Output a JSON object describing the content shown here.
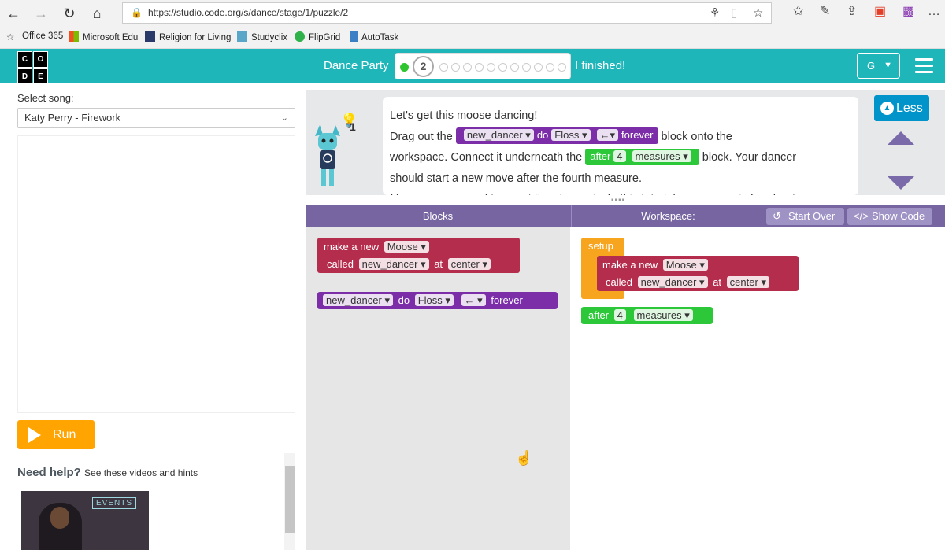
{
  "browser": {
    "url": "https://studio.code.org/s/dance/stage/1/puzzle/2",
    "bookmarks": [
      "Office 365",
      "Microsoft Edu",
      "Religion for Living",
      "Studyclix",
      "FlipGrid",
      "AutoTask"
    ]
  },
  "header": {
    "logo_letters": [
      "C",
      "O",
      "D",
      "E"
    ],
    "level_label": "Dance Party",
    "current_puzzle": "2",
    "finished_label": "I finished!",
    "user_initial": "G",
    "brand_color": "#1fb6ba"
  },
  "left_panel": {
    "song_label": "Select song:",
    "song_value": "Katy Perry - Firework",
    "run_label": "Run",
    "help_title": "Need help?",
    "help_subtitle": "See these videos and hints",
    "video_caption": "EVENTS"
  },
  "instructions": {
    "hint_count": "1",
    "line1": "Let's get this moose dancing!",
    "line2_pre": "Drag out the",
    "line2_post": "block onto the",
    "line3_pre": "workspace. Connect it underneath the",
    "line3_post": "block. Your dancer",
    "line4": "should start a new move after the fourth measure.",
    "line5": "Measures are used to count time in music. In this tutorial, a measure is four beats.",
    "less_label": "Less"
  },
  "workspace_header": {
    "blocks_label": "Blocks",
    "workspace_label": "Workspace:",
    "start_over_label": "Start Over",
    "show_code_label": "Show Code"
  },
  "blocks": {
    "make_a_new": "make a new",
    "moose": "Moose",
    "called": "called",
    "new_dancer": "new_dancer",
    "at": "at",
    "center": "center",
    "do": "do",
    "floss": "Floss",
    "arrow": "←",
    "forever": "forever",
    "setup": "setup",
    "after": "after",
    "four": "4",
    "measures": "measures",
    "drop_arrow": "▾"
  },
  "colors": {
    "purple_block": "#7b2ea8",
    "green_block": "#2dc83a",
    "red_block": "#b52d4c",
    "orange_block": "#f7a51e",
    "run_button": "#ffa400",
    "less_button": "#0094ca"
  }
}
